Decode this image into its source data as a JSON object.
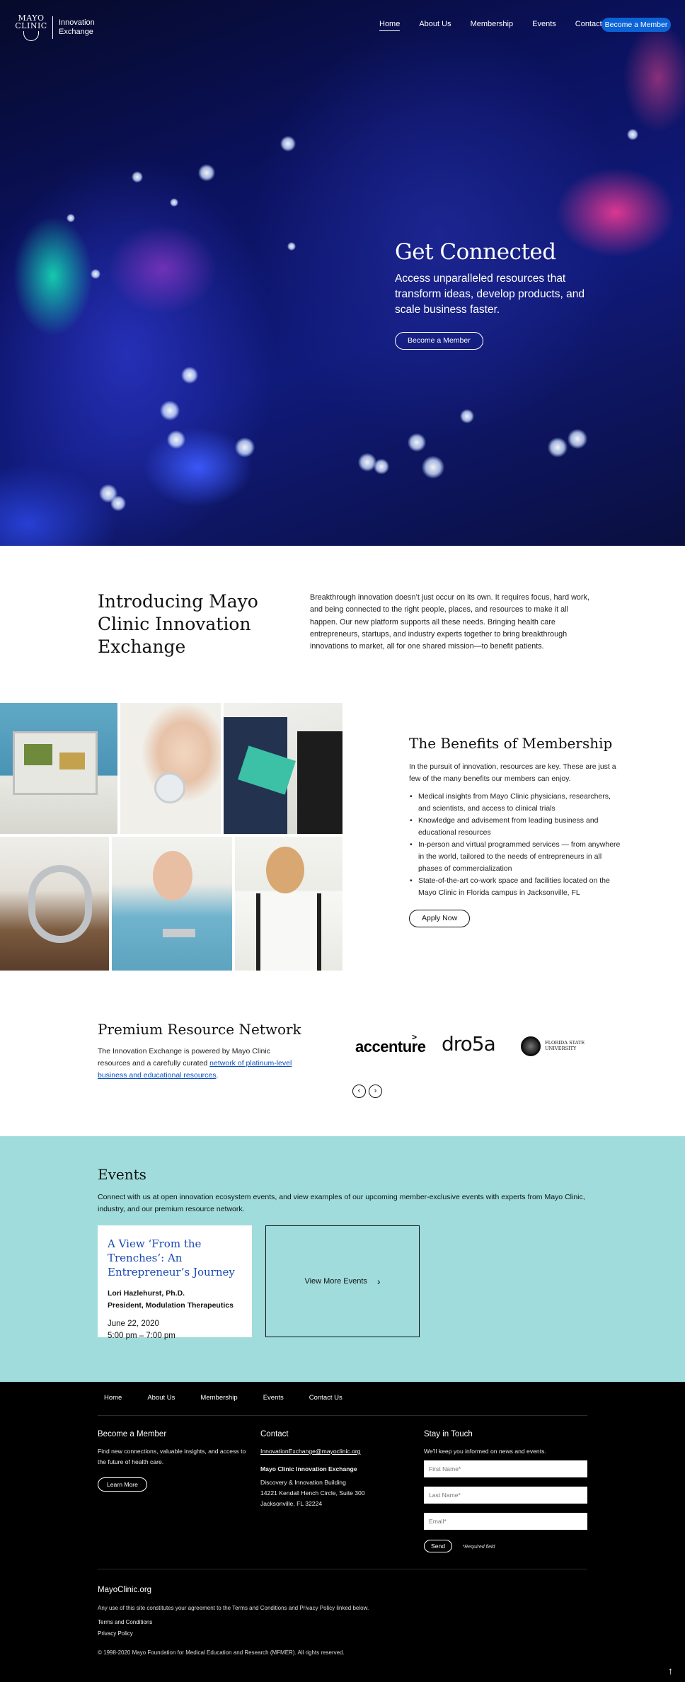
{
  "header": {
    "logo_line1": "MAYO",
    "logo_line2": "CLINIC",
    "logo_sub1": "Innovation",
    "logo_sub2": "Exchange",
    "nav": [
      "Home",
      "About Us",
      "Membership",
      "Events",
      "Contact Us"
    ],
    "active_nav": "Home",
    "cta": "Become a Member"
  },
  "hero": {
    "title": "Get Connected",
    "subtitle": "Access unparalleled resources that transform ideas, develop products, and scale business faster.",
    "button": "Become a Member"
  },
  "intro": {
    "title": "Introducing Mayo Clinic Innovation Exchange",
    "body": "Breakthrough innovation doesn’t just occur on its own. It requires focus, hard work, and being connected to the right people, places, and resources to make it all happen. Our new platform supports all these needs. Bringing health care entrepreneurs, startups, and industry experts together to bring breakthrough innovations to market, all for one shared mission—to benefit patients."
  },
  "benefits": {
    "title": "The Benefits of Membership",
    "lead": "In the pursuit of innovation, resources are key. These are just a few of the many benefits our members can enjoy.",
    "items": [
      "Medical insights from Mayo Clinic physicians, researchers, and scientists, and access to clinical trials",
      "Knowledge and advisement from leading business and educational resources",
      "In-person and virtual programmed services — from anywhere in the world, tailored to the needs of entrepreneurs in all phases of commercialization",
      "State-of-the-art co-work space and facilities located on the Mayo Clinic in Florida campus in Jacksonville, FL"
    ],
    "button": "Apply Now"
  },
  "premium": {
    "title": "Premium Resource Network",
    "body_before": "The Innovation Exchange is powered by Mayo Clinic resources and a carefully curated ",
    "link": "network of platinum-level business and educational resources",
    "body_after": ".",
    "logos": [
      "accenture",
      "dro5a",
      "FLORIDA STATE UNIVERSITY"
    ]
  },
  "events": {
    "title": "Events",
    "lead": "Connect with us at open innovation ecosystem events, and view examples of our upcoming member-exclusive events with experts from Mayo Clinic, industry, and our premium resource network.",
    "card": {
      "title": "A View ‘From the Trenches’: An Entrepreneur’s Journey",
      "speaker": "Lori Hazlehurst, Ph.D.",
      "role": "President, Modulation Therapeutics",
      "date": "June 22, 2020",
      "time": "5:00 pm – 7:00 pm"
    },
    "more": "View More Events"
  },
  "footer": {
    "nav": [
      "Home",
      "About Us",
      "Membership",
      "Events",
      "Contact Us"
    ],
    "member": {
      "title": "Become a Member",
      "text": "Find new connections, valuable insights, and access to the future of health care.",
      "button": "Learn More"
    },
    "contact": {
      "title": "Contact",
      "email": "InnovationExchange@mayoclinic.org",
      "org": "Mayo Clinic Innovation Exchange",
      "address1": "Discovery & Innovation Building",
      "address2": "14221 Kendall Hench Circle, Suite 300",
      "address3": "Jacksonville, FL 32224"
    },
    "stay": {
      "title": "Stay in Touch",
      "text": "We’ll keep you informed on news and events.",
      "first": "First Name*",
      "last": "Last Name*",
      "email": "Email*",
      "send": "Send",
      "required": "*Required field"
    },
    "site": "MayoClinic.org",
    "legal": "Any use of this site constitutes your agreement to the Terms and Conditions and Privacy Policy linked below.",
    "terms": "Terms and Conditions",
    "privacy": "Privacy Policy",
    "copyright": "© 1998-2020 Mayo Foundation for Medical Education and Research (MFMER). All rights reserved."
  },
  "icons": {
    "carousel_prev": "chevron-left-icon",
    "carousel_next": "chevron-right-icon",
    "event_more": "chevron-right-icon",
    "back_to_top": "arrow-up-icon"
  },
  "colors": {
    "primary": "#0b63d6",
    "events_bg": "#a0dcdc",
    "footer_bg": "#000000",
    "link": "#0b4fc2"
  }
}
